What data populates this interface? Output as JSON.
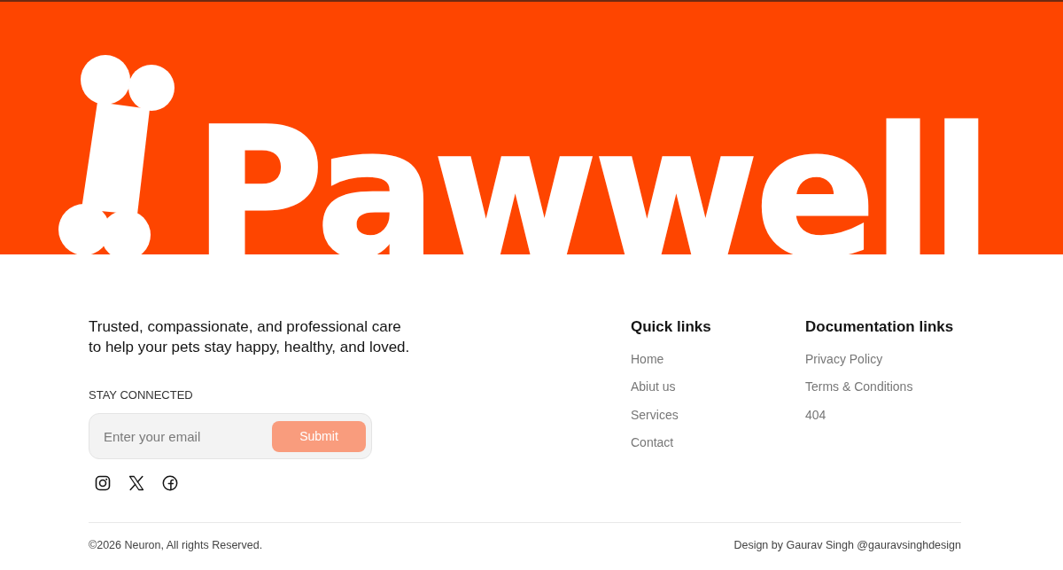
{
  "banner": {
    "brand": "Pawwell"
  },
  "about": {
    "tagline": "Trusted, compassionate, and professional care\nto help your pets stay happy, healthy, and loved.",
    "newsletter_label": "STAY CONNECTED",
    "email_placeholder": "Enter your email",
    "submit": "Submit"
  },
  "link_columns": [
    {
      "heading": "Quick links",
      "links": [
        "Home",
        "Abiut us",
        "Services",
        "Contact"
      ]
    },
    {
      "heading": "Documentation links",
      "links": [
        "Privacy Policy",
        "Terms & Conditions",
        "404"
      ]
    }
  ],
  "bottom_bar": {
    "copyright": "©2026 Neuron, All rights Reserved.",
    "credit": "Design by Gaurav Singh @gauravsinghdesign"
  }
}
